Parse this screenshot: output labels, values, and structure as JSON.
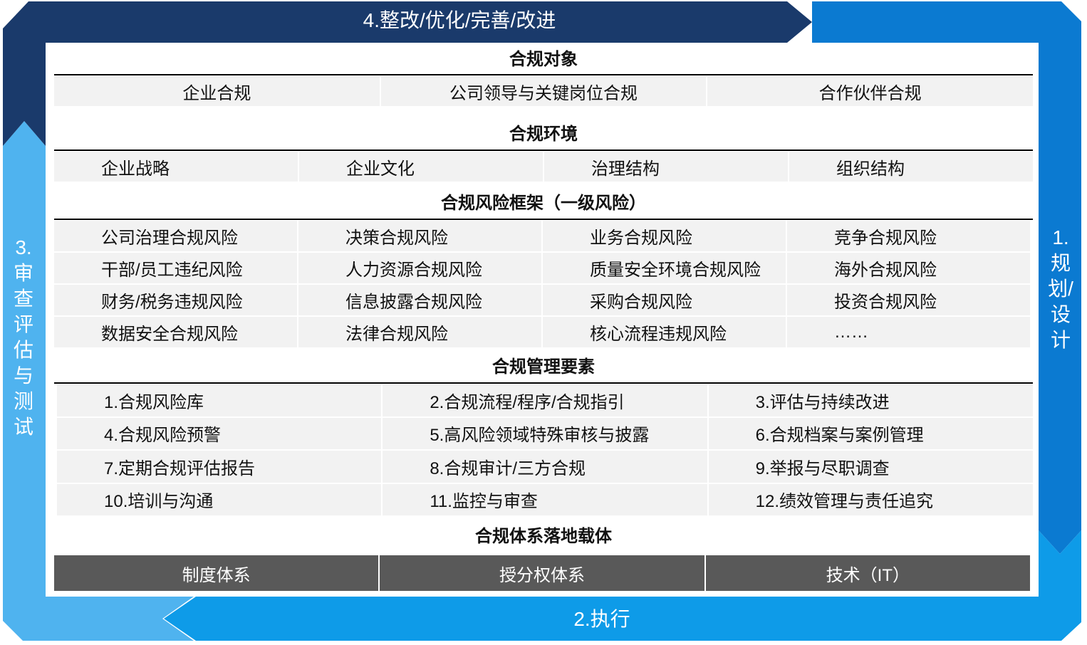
{
  "cycle": {
    "top": "4.整改/优化/完善/改进",
    "right": [
      "1.",
      "规",
      "划/",
      "设",
      "计"
    ],
    "bottom": "2.执行",
    "left": [
      "3.",
      "审",
      "查",
      "评",
      "估",
      "与",
      "测",
      "试"
    ],
    "colors": {
      "navy": "#1a3a6b",
      "mid": "#0b7ad1",
      "light": "#4fb3ef"
    }
  },
  "objects": {
    "title": "合规对象",
    "items": [
      "企业合规",
      "公司领导与关键岗位合规",
      "合作伙伴合规"
    ]
  },
  "environment": {
    "title": "合规环境",
    "items": [
      "企业战略",
      "企业文化",
      "治理结构",
      "组织结构"
    ]
  },
  "risk": {
    "title": "合规风险框架（一级风险）",
    "items": [
      "公司治理合规风险",
      "决策合规风险",
      "业务合规风险",
      "竞争合规风险",
      "干部/员工违纪风险",
      "人力资源合规风险",
      "质量安全环境合规风险",
      "海外合规风险",
      "财务/税务违规风险",
      "信息披露合规风险",
      "采购合规风险",
      "投资合规风险",
      "数据安全合规风险",
      "法律合规风险",
      "核心流程违规风险",
      "……"
    ]
  },
  "elements": {
    "title": "合规管理要素",
    "items": [
      "1.合规风险库",
      "2.合规流程/程序/合规指引",
      "3.评估与持续改进",
      "4.合规风险预警",
      "5.高风险领域特殊审核与披露",
      "6.合规档案与案例管理",
      "7.定期合规评估报告",
      "8.合规审计/三方合规",
      "9.举报与尽职调查",
      "10.培训与沟通",
      "11.监控与审查",
      "12.绩效管理与责任追究"
    ]
  },
  "carrier": {
    "title": "合规体系落地载体",
    "items": [
      "制度体系",
      "授分权体系",
      "技术（IT）"
    ]
  }
}
